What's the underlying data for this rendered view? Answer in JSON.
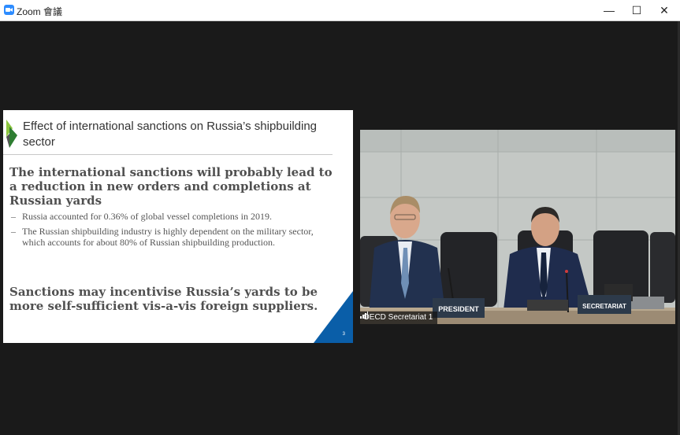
{
  "window": {
    "title": "Zoom 會議",
    "min_glyph": "—",
    "max_glyph": "☐",
    "close_glyph": "✕"
  },
  "slide": {
    "title": "Effect of international sanctions on Russia’s shipbuilding sector",
    "heading1": "The international sanctions will probably lead to a reduction in new orders and completions at Russian yards",
    "bullets": [
      "Russia accounted for 0.36% of global vessel completions in 2019.",
      "The Russian shipbuilding industry is highly dependent on the military sector, which accounts for about 80% of Russian shipbuilding production."
    ],
    "bullet_marker": "–",
    "heading2": "Sanctions may incentivise Russia’s yards to be more self-sufficient vis-a-vis foreign suppliers.",
    "page_number": "3",
    "accent_color": "#0a5ea8"
  },
  "video": {
    "participant_name": "OECD Secretariat 1",
    "placard_left": "PRESIDENT",
    "placard_right": "SECRETARIAT"
  }
}
